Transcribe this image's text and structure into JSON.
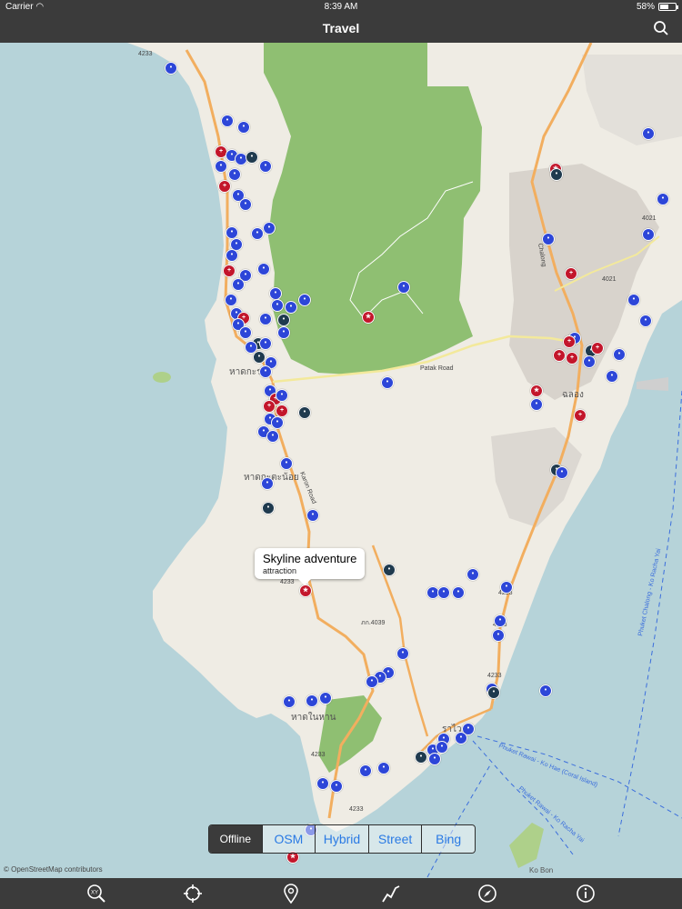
{
  "status": {
    "carrier": "Carrier",
    "time": "8:39 AM",
    "battery": "58%",
    "battery_level": 0.58
  },
  "nav": {
    "title": "Travel"
  },
  "callout": {
    "title": "Skyline adventure",
    "subtitle": "attraction"
  },
  "layers": {
    "items": [
      "Offline",
      "OSM",
      "Hybrid",
      "Street",
      "Bing"
    ],
    "selected": "Offline"
  },
  "map": {
    "road_labels": [
      "4233",
      "4233",
      "4233",
      "4233",
      "4233",
      "4233",
      "4233",
      "4021",
      "4021",
      "ภก.4039",
      "Patak Road",
      "Karon Road",
      "Chalong"
    ],
    "place_labels": [
      "หาดกะรน",
      "หาดกะตะน้อย",
      "หาดในหาน",
      "ราไวย์",
      "ฉลอง",
      "Ko Bon"
    ],
    "ferry_labels": [
      "Phuket Chalong - Ko Racha Yai",
      "Phuket Rawai - Ko Hae (Coral Island)",
      "Phuket Rawai - Ko Racha Yai"
    ],
    "attribution": "© OpenStreetMap contributors"
  },
  "colors": {
    "water": "#b6d3d9",
    "land": "#efece4",
    "forest": "#8fbf72",
    "road": "#f2ae5f",
    "poi_blue": "#2d46d8",
    "poi_red": "#c3162b",
    "poi_atm": "#1f3a4e",
    "bar": "#3b3b3b",
    "accent": "#2a7ae4"
  },
  "tabs": [
    "xy-search-icon",
    "crosshair-icon",
    "pin-icon",
    "route-icon",
    "compass-icon",
    "info-icon"
  ]
}
